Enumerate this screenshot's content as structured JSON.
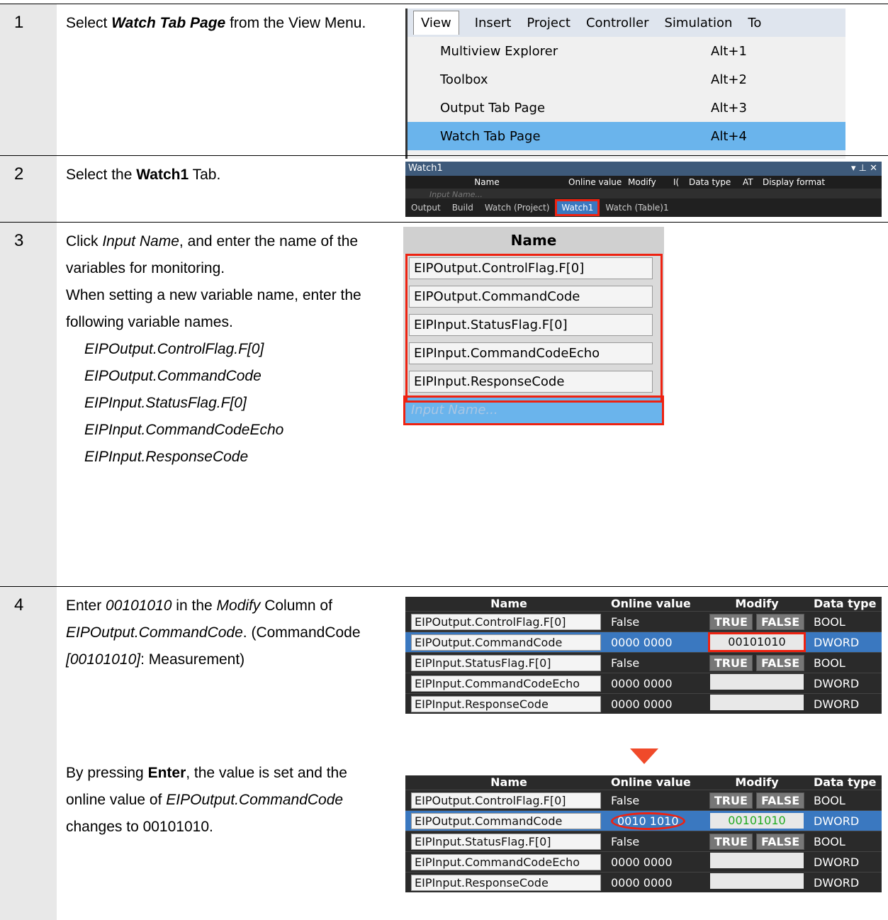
{
  "steps": [
    {
      "num": "1",
      "text_parts": [
        "Select ",
        "Watch Tab Page",
        " from the View Menu."
      ]
    },
    {
      "num": "2",
      "text_parts": [
        "Select the ",
        "Watch1",
        " Tab."
      ]
    },
    {
      "num": "3",
      "lines": [
        "Click ",
        "Input Name",
        ", and enter the name of the variables for monitoring.",
        "When setting a new variable name, enter the following variable names."
      ],
      "vars": [
        "EIPOutput.ControlFlag.F[0]",
        "EIPOutput.CommandCode",
        "EIPInput.StatusFlag.F[0]",
        "EIPInput.CommandCodeEcho",
        "EIPInput.ResponseCode"
      ]
    },
    {
      "num": "4",
      "a": [
        "Enter ",
        "00101010",
        " in the ",
        "Modify",
        " Column of ",
        "EIPOutput.CommandCode",
        ". (CommandCode ",
        "[00101010]",
        ": Measurement)"
      ],
      "b": [
        "By pressing ",
        "Enter",
        ", the value is set and the online value of ",
        "EIPOutput.CommandCode",
        " changes to 00101010."
      ]
    }
  ],
  "menu": {
    "bar": [
      "View",
      "Insert",
      "Project",
      "Controller",
      "Simulation",
      "To"
    ],
    "items": [
      {
        "label": "Multiview Explorer",
        "shortcut": "Alt+1"
      },
      {
        "label": "Toolbox",
        "shortcut": "Alt+2"
      },
      {
        "label": "Output Tab Page",
        "shortcut": "Alt+3"
      },
      {
        "label": "Watch Tab Page",
        "shortcut": "Alt+4"
      }
    ]
  },
  "watch": {
    "title": "Watch1",
    "controls": "▾ ⊥ ✕",
    "headers": [
      "Name",
      "Online value",
      "Modify",
      "I(",
      "Data type",
      "AT",
      "Display format"
    ],
    "input_placeholder": "Input Name...",
    "tabs": [
      "Output",
      "Build",
      "Watch (Project)",
      "Watch1",
      "Watch (Table)1"
    ]
  },
  "names": {
    "header": "Name",
    "rows": [
      "EIPOutput.ControlFlag.F[0]",
      "EIPOutput.CommandCode",
      "EIPInput.StatusFlag.F[0]",
      "EIPInput.CommandCodeEcho",
      "EIPInput.ResponseCode"
    ],
    "input": "Input Name..."
  },
  "grid_headers": [
    "Name",
    "Online value",
    "Modify",
    "Data type"
  ],
  "grid1": [
    {
      "name": "EIPOutput.ControlFlag.F[0]",
      "value": "False",
      "modify": "bool",
      "type": "BOOL"
    },
    {
      "name": "EIPOutput.CommandCode",
      "value": "0000 0000",
      "modify": "00101010",
      "type": "DWORD"
    },
    {
      "name": "EIPInput.StatusFlag.F[0]",
      "value": "False",
      "modify": "bool",
      "type": "BOOL"
    },
    {
      "name": "EIPInput.CommandCodeEcho",
      "value": "0000 0000",
      "modify": "",
      "type": "DWORD"
    },
    {
      "name": "EIPInput.ResponseCode",
      "value": "0000 0000",
      "modify": "",
      "type": "DWORD"
    }
  ],
  "grid2": [
    {
      "name": "EIPOutput.ControlFlag.F[0]",
      "value": "False",
      "modify": "bool",
      "type": "BOOL"
    },
    {
      "name": "EIPOutput.CommandCode",
      "value": "0010 1010",
      "modify": "00101010",
      "type": "DWORD"
    },
    {
      "name": "EIPInput.StatusFlag.F[0]",
      "value": "False",
      "modify": "bool",
      "type": "BOOL"
    },
    {
      "name": "EIPInput.CommandCodeEcho",
      "value": "0000 0000",
      "modify": "",
      "type": "DWORD"
    },
    {
      "name": "EIPInput.ResponseCode",
      "value": "0000 0000",
      "modify": "",
      "type": "DWORD"
    }
  ],
  "btn_true": "TRUE",
  "btn_false": "FALSE"
}
